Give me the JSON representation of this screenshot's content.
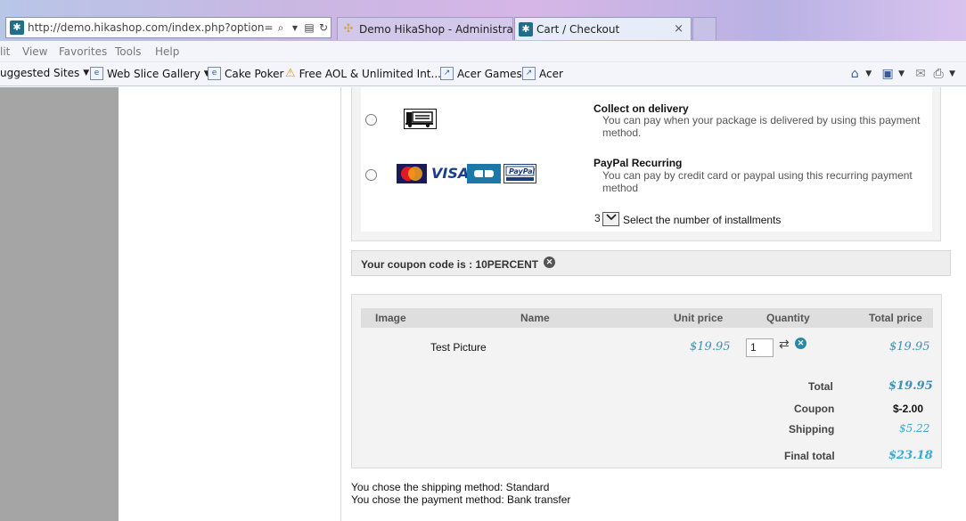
{
  "browser": {
    "address": "http://demo.hikashop.com/index.php?option=con",
    "tabs": [
      {
        "label": "Demo HikaShop - Administrati..."
      },
      {
        "label": "Cart / Checkout",
        "close": "×"
      }
    ],
    "menu": [
      "lit",
      "View",
      "Favorites",
      "Tools",
      "Help"
    ],
    "favorites": [
      {
        "label": "uggested Sites",
        "icon": "suggested-sites-icon"
      },
      {
        "label": "Web Slice Gallery",
        "icon": "ie-icon"
      },
      {
        "label": "Cake Poker",
        "icon": "ie-icon"
      },
      {
        "label": "Free AOL & Unlimited Int...",
        "icon": "warning-icon"
      },
      {
        "label": "Acer Games",
        "icon": "page-icon"
      },
      {
        "label": "Acer",
        "icon": "page-icon"
      }
    ]
  },
  "payment": {
    "methods": [
      {
        "title": "Collect on delivery",
        "description": "You can pay when your package is delivered by using this payment method."
      },
      {
        "title": "PayPal Recurring",
        "description": "You can pay by credit card or paypal using this recurring payment method",
        "cards": [
          "MasterCard",
          "VISA",
          "CB",
          "PayPal"
        ]
      }
    ],
    "installments_value": "3",
    "installments_label": "Select the number of installments"
  },
  "coupon": {
    "text": "Your coupon code is : 10PERCENT"
  },
  "cart": {
    "headers": {
      "image": "Image",
      "name": "Name",
      "unit_price": "Unit price",
      "quantity": "Quantity",
      "total_price": "Total price"
    },
    "items": [
      {
        "name": "Test Picture",
        "unit_price": "$19.95",
        "quantity": "1",
        "total_price": "$19.95"
      }
    ],
    "totals": {
      "total_label": "Total",
      "total_value": "$19.95",
      "coupon_label": "Coupon",
      "coupon_value": "$-2.00",
      "shipping_label": "Shipping",
      "shipping_value": "$5.22",
      "final_label": "Final total",
      "final_value": "$23.18"
    }
  },
  "summary": {
    "shipping": "You chose the shipping method: Standard",
    "payment": "You chose the payment method: Bank transfer"
  },
  "colors": {
    "price": "#3f8fb0",
    "shipping": "#3aa7d6",
    "remove": "#2c88a8"
  }
}
